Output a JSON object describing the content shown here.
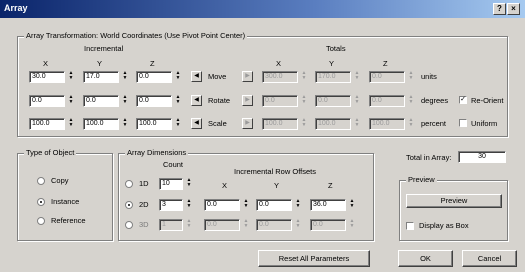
{
  "window": {
    "title": "Array",
    "help_glyph": "?",
    "close_glyph": "×"
  },
  "transform": {
    "legend": "Array Transformation: World Coordinates (Use Pivot Point Center)",
    "incremental_label": "Incremental",
    "totals_label": "Totals",
    "axes": [
      "X",
      "Y",
      "Z"
    ],
    "rows": [
      {
        "label": "Move",
        "inc": [
          "30.0",
          "17.0",
          "0.0"
        ],
        "tot": [
          "300.0",
          "170.0",
          "0.0"
        ],
        "unit": "units"
      },
      {
        "label": "Rotate",
        "inc": [
          "0.0",
          "0.0",
          "0.0"
        ],
        "tot": [
          "0.0",
          "0.0",
          "0.0"
        ],
        "unit": "degrees"
      },
      {
        "label": "Scale",
        "inc": [
          "100.0",
          "100.0",
          "100.0"
        ],
        "tot": [
          "100.0",
          "100.0",
          "100.0"
        ],
        "unit": "percent"
      }
    ],
    "re_orient": {
      "label": "Re-Orient",
      "checked": true
    },
    "uniform": {
      "label": "Uniform",
      "checked": false
    }
  },
  "type_of_object": {
    "legend": "Type of Object",
    "options": [
      {
        "label": "Copy",
        "selected": false
      },
      {
        "label": "Instance",
        "selected": true
      },
      {
        "label": "Reference",
        "selected": false
      }
    ]
  },
  "array_dimensions": {
    "legend": "Array Dimensions",
    "count_label": "Count",
    "offsets_label": "Incremental Row Offsets",
    "axes": [
      "X",
      "Y",
      "Z"
    ],
    "rows": [
      {
        "label": "1D",
        "selected": false,
        "count": "10",
        "offsets": []
      },
      {
        "label": "2D",
        "selected": true,
        "count": "3",
        "offsets": [
          "0.0",
          "0.0",
          "36.0"
        ]
      },
      {
        "label": "3D",
        "selected": false,
        "count": "1",
        "offsets": [
          "0.0",
          "0.0",
          "0.0"
        ]
      }
    ]
  },
  "total_in_array": {
    "label": "Total in Array:",
    "value": "30"
  },
  "preview": {
    "legend": "Preview",
    "button": "Preview",
    "display_as_box": {
      "label": "Display as Box",
      "checked": false
    }
  },
  "buttons": {
    "reset": "Reset All Parameters",
    "ok": "OK",
    "cancel": "Cancel"
  }
}
